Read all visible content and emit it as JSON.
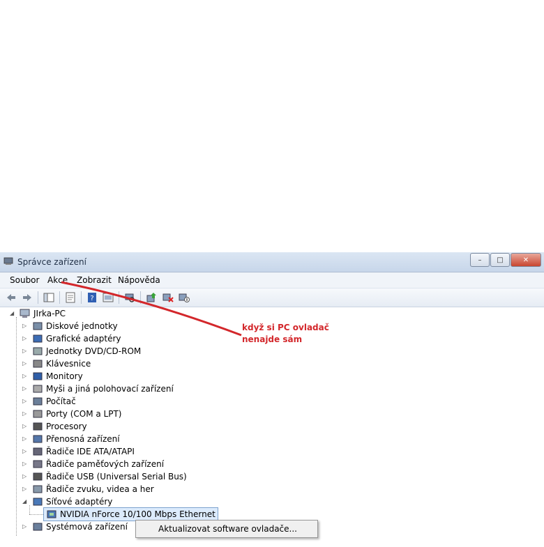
{
  "window": {
    "title": "Správce zařízení",
    "buttons": {
      "minimize": "–",
      "maximize": "□",
      "close": "✕"
    }
  },
  "menu": [
    "Soubor",
    "Akce",
    "Zobrazit",
    "Nápověda"
  ],
  "tree": {
    "root": "JIrka-PC",
    "items": [
      {
        "label": "Diskové jednotky",
        "icon": "disk-icon"
      },
      {
        "label": "Grafické adaptéry",
        "icon": "display-adapter-icon"
      },
      {
        "label": "Jednotky DVD/CD-ROM",
        "icon": "dvd-icon"
      },
      {
        "label": "Klávesnice",
        "icon": "keyboard-icon"
      },
      {
        "label": "Monitory",
        "icon": "monitor-icon"
      },
      {
        "label": "Myši a jiná polohovací zařízení",
        "icon": "mouse-icon"
      },
      {
        "label": "Počítač",
        "icon": "computer-icon"
      },
      {
        "label": "Porty (COM a LPT)",
        "icon": "port-icon"
      },
      {
        "label": "Procesory",
        "icon": "processor-icon"
      },
      {
        "label": "Přenosná zařízení",
        "icon": "portable-device-icon"
      },
      {
        "label": "Řadiče IDE ATA/ATAPI",
        "icon": "ide-controller-icon"
      },
      {
        "label": "Řadiče paměťových zařízení",
        "icon": "storage-controller-icon"
      },
      {
        "label": "Řadiče USB (Universal Serial Bus)",
        "icon": "usb-icon"
      },
      {
        "label": "Řadiče zvuku, videa a her",
        "icon": "sound-icon"
      },
      {
        "label": "Síťové adaptéry",
        "icon": "network-adapter-icon"
      },
      {
        "label": "Systémová zařízení",
        "icon": "system-device-icon"
      }
    ],
    "child": {
      "label": "NVIDIA nForce 10/100 Mbps Ethernet",
      "icon": "network-card-icon"
    }
  },
  "context_menu": {
    "item": "Aktualizovat software ovladače..."
  },
  "annotation": {
    "line1": "když si PC ovladač",
    "line2": "nenajde sám"
  },
  "colors": {
    "annotation": "#d3272b",
    "selection": "#dcebfc"
  }
}
